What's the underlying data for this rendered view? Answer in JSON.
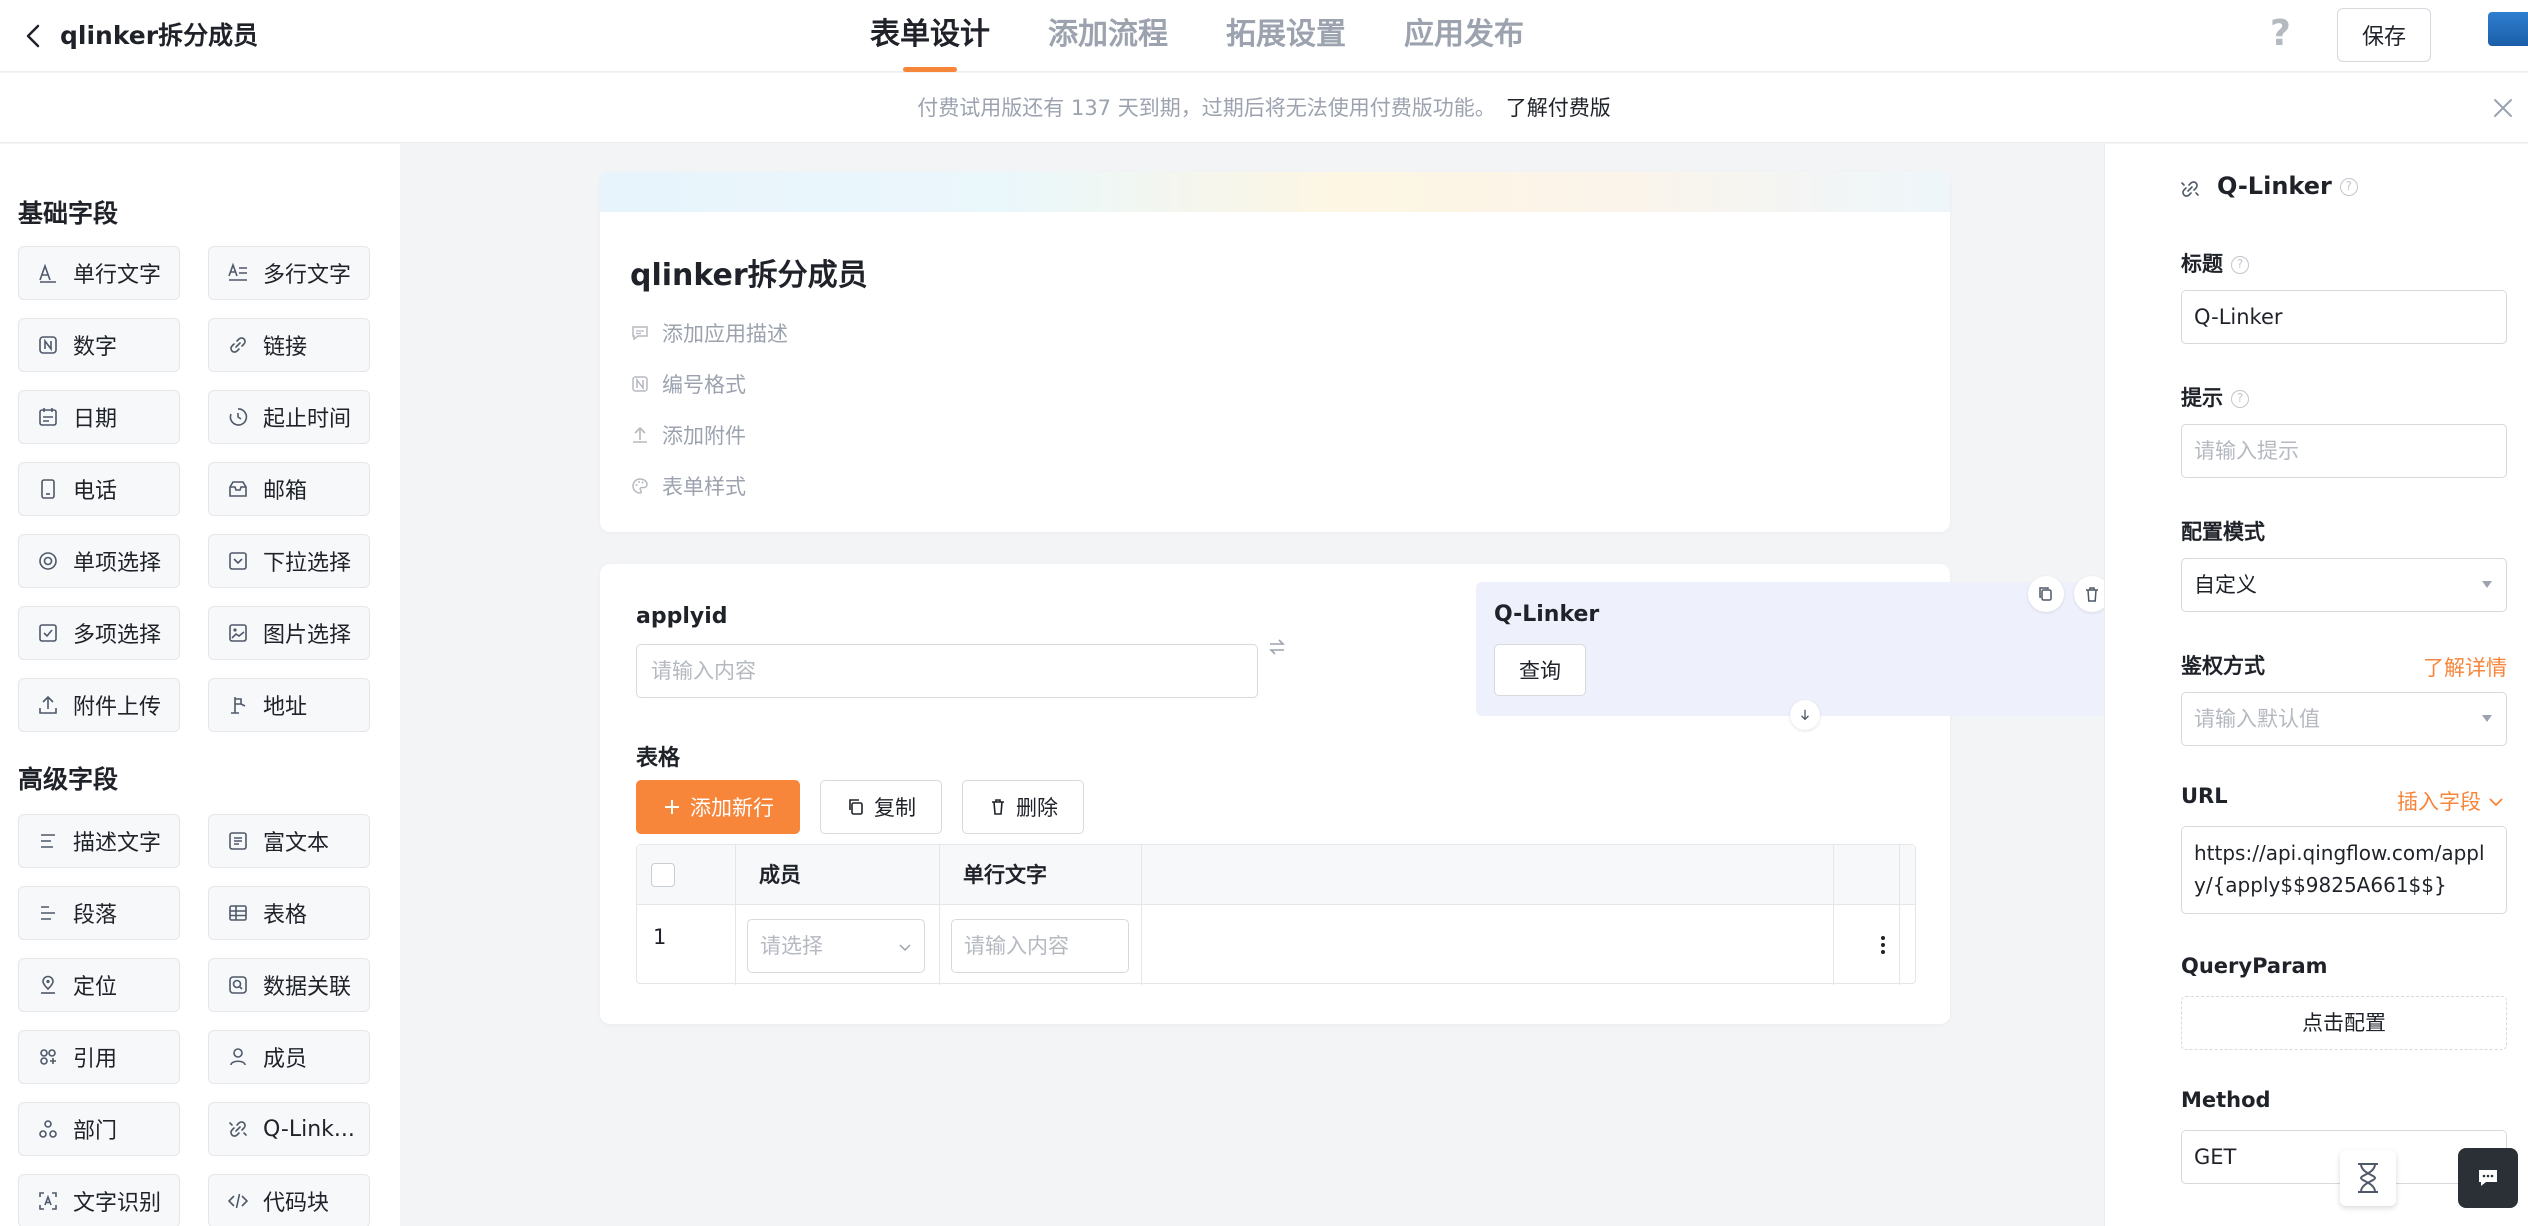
{
  "header": {
    "app_title": "qlinker拆分成员",
    "tabs": [
      {
        "label": "表单设计",
        "active": true
      },
      {
        "label": "添加流程",
        "active": false
      },
      {
        "label": "拓展设置",
        "active": false
      },
      {
        "label": "应用发布",
        "active": false
      }
    ],
    "help_label": "?",
    "save_label": "保存"
  },
  "notice": {
    "text": "付费试用版还有 137 天到期，过期后将无法使用付费版功能。",
    "link": "了解付费版"
  },
  "sidebar": {
    "basic_title": "基础字段",
    "basic_fields": [
      {
        "label": "单行文字",
        "icon": "single-line-text-icon"
      },
      {
        "label": "多行文字",
        "icon": "multi-line-text-icon"
      },
      {
        "label": "数字",
        "icon": "number-icon"
      },
      {
        "label": "链接",
        "icon": "link-icon"
      },
      {
        "label": "日期",
        "icon": "date-icon"
      },
      {
        "label": "起止时间",
        "icon": "time-range-icon"
      },
      {
        "label": "电话",
        "icon": "phone-icon"
      },
      {
        "label": "邮箱",
        "icon": "email-icon"
      },
      {
        "label": "单项选择",
        "icon": "radio-icon"
      },
      {
        "label": "下拉选择",
        "icon": "dropdown-icon"
      },
      {
        "label": "多项选择",
        "icon": "checkbox-icon"
      },
      {
        "label": "图片选择",
        "icon": "image-icon"
      },
      {
        "label": "附件上传",
        "icon": "upload-icon"
      },
      {
        "label": "地址",
        "icon": "address-icon"
      }
    ],
    "advanced_title": "高级字段",
    "advanced_fields": [
      {
        "label": "描述文字",
        "icon": "description-icon"
      },
      {
        "label": "富文本",
        "icon": "rich-text-icon"
      },
      {
        "label": "段落",
        "icon": "paragraph-icon"
      },
      {
        "label": "表格",
        "icon": "table-icon"
      },
      {
        "label": "定位",
        "icon": "location-icon"
      },
      {
        "label": "数据关联",
        "icon": "data-link-icon"
      },
      {
        "label": "引用",
        "icon": "reference-icon"
      },
      {
        "label": "成员",
        "icon": "member-icon"
      },
      {
        "label": "部门",
        "icon": "department-icon"
      },
      {
        "label": "Q-Link...",
        "icon": "q-linker-icon"
      },
      {
        "label": "文字识别",
        "icon": "ocr-icon"
      },
      {
        "label": "代码块",
        "icon": "code-block-icon"
      }
    ]
  },
  "form": {
    "title": "qlinker拆分成员",
    "options": [
      {
        "label": "添加应用描述",
        "icon": "comment-icon"
      },
      {
        "label": "编号格式",
        "icon": "number-format-icon"
      },
      {
        "label": "添加附件",
        "icon": "upload-icon"
      },
      {
        "label": "表单样式",
        "icon": "palette-icon"
      }
    ]
  },
  "fields": {
    "applyid_label": "applyid",
    "applyid_placeholder": "请输入内容",
    "qlinker_label": "Q-Linker",
    "query_button": "查询",
    "table_label": "表格",
    "add_row": "添加新行",
    "copy": "复制",
    "delete": "删除",
    "table_headers": [
      "成员",
      "单行文字"
    ],
    "row_number": "1",
    "select_placeholder": "请选择",
    "cell_placeholder": "请输入内容"
  },
  "panel": {
    "title": "Q-Linker",
    "title_label": "标题",
    "title_value": "Q-Linker",
    "hint_label": "提示",
    "hint_placeholder": "请输入提示",
    "mode_label": "配置模式",
    "mode_value": "自定义",
    "auth_label": "鉴权方式",
    "auth_link": "了解详情",
    "auth_placeholder": "请输入默认值",
    "url_label": "URL",
    "insert_field": "插入字段",
    "url_value": "https://api.qingflow.com/apply/{apply$$9825A661$$}",
    "queryparam_label": "QueryParam",
    "config_button": "点击配置",
    "method_label": "Method",
    "method_value": "GET"
  },
  "colors": {
    "accent": "#f7853a",
    "qlinker_bg": "#eef1fc"
  }
}
